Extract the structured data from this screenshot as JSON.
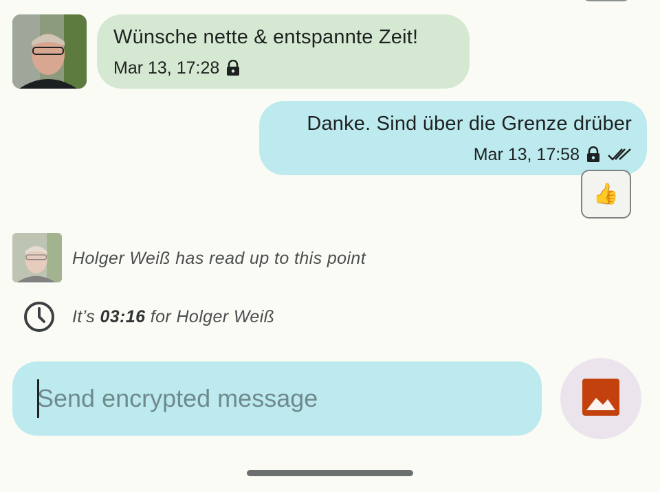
{
  "messages": [
    {
      "direction": "incoming",
      "text": "Wünsche nette & entspannte Zeit!",
      "timestamp": "Mar 13, 17:28",
      "encrypted": true
    },
    {
      "direction": "outgoing",
      "text": "Danke. Sind über die Grenze drüber",
      "timestamp": "Mar 13, 17:58",
      "encrypted": true,
      "status": "read",
      "reaction": "👍"
    }
  ],
  "read_marker": {
    "text": "Holger Weiß has read up to this point"
  },
  "local_time": {
    "prefix": "It’s ",
    "time": "03:16",
    "suffix": " for Holger Weiß"
  },
  "composer": {
    "placeholder": "Send encrypted message",
    "value": ""
  },
  "icons": {
    "lock": "lock-icon",
    "read": "double-check-icon",
    "clock": "clock-icon",
    "media": "image-icon"
  },
  "colors": {
    "incoming_bubble": "#d5e8d1",
    "outgoing_bubble": "#bdeaef",
    "media_icon": "#c2410c",
    "background": "#fbfbf5"
  }
}
